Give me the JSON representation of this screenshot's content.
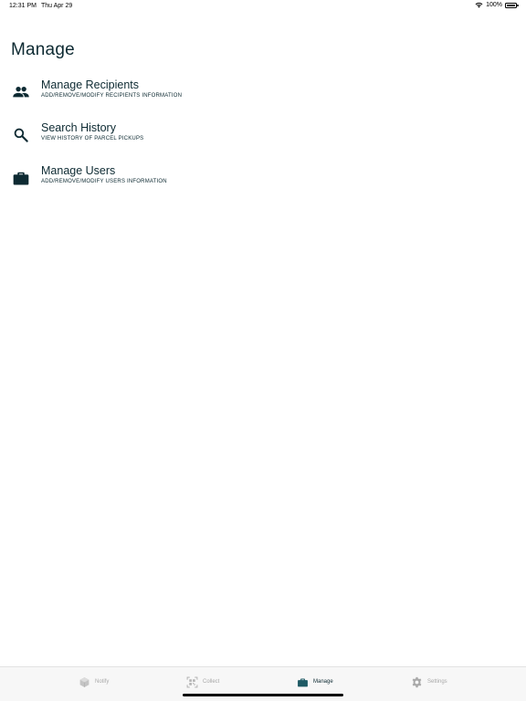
{
  "status": {
    "time": "12:31 PM",
    "date": "Thu Apr 29",
    "battery": "100%"
  },
  "page": {
    "title": "Manage"
  },
  "menu": [
    {
      "title": "Manage Recipients",
      "subtitle": "ADD/REMOVE/MODIFY RECIPIENTS INFORMATION",
      "icon": "people-icon"
    },
    {
      "title": "Search History",
      "subtitle": "VIEW HISTORY OF PARCEL PICKUPS",
      "icon": "search-icon"
    },
    {
      "title": "Manage Users",
      "subtitle": "ADD/REMOVE/MODIFY USERS INFORMATION",
      "icon": "briefcase-icon"
    }
  ],
  "tabs": [
    {
      "label": "Notify",
      "icon": "package-icon"
    },
    {
      "label": "Collect",
      "icon": "qr-scan-icon"
    },
    {
      "label": "Manage",
      "icon": "briefcase-icon"
    },
    {
      "label": "Settings",
      "icon": "gear-icon"
    }
  ],
  "colors": {
    "accent": "#1e5a64",
    "text": "#0d2a32",
    "inactive": "#a9a9a9"
  }
}
